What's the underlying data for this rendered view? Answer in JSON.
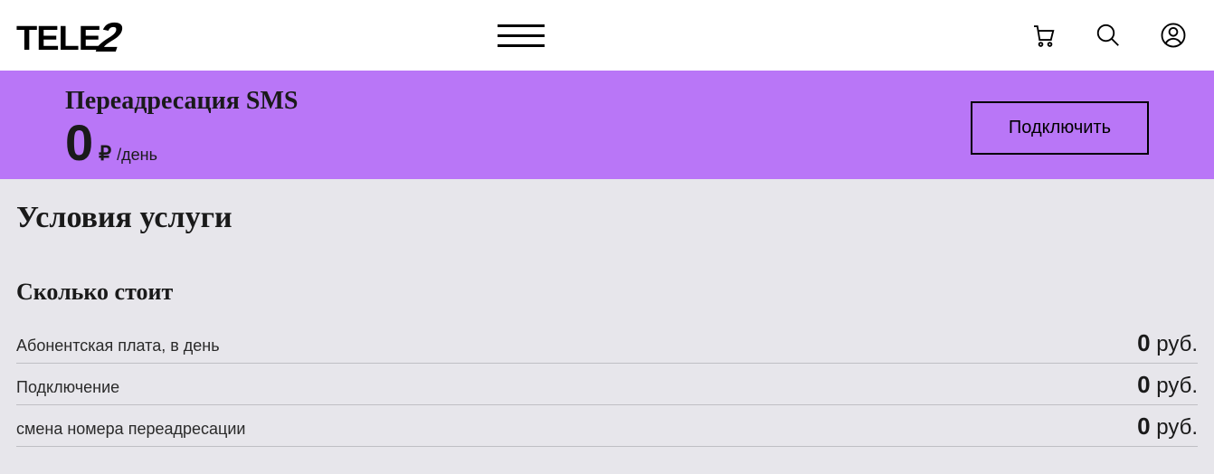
{
  "header": {
    "logo_text": "TELE",
    "logo_suffix": "2"
  },
  "banner": {
    "title": "Переадресация SMS",
    "price_amount": "0",
    "price_currency": "₽",
    "price_period": "/день",
    "connect_label": "Подключить"
  },
  "main": {
    "section_title": "Условия услуги",
    "sub_title": "Сколько стоит",
    "rows": [
      {
        "label": "Абонентская плата, в день",
        "value": "0",
        "unit": "руб."
      },
      {
        "label": "Подключение",
        "value": "0",
        "unit": "руб."
      },
      {
        "label": "смена номера переадресации",
        "value": "0",
        "unit": "руб."
      }
    ]
  }
}
